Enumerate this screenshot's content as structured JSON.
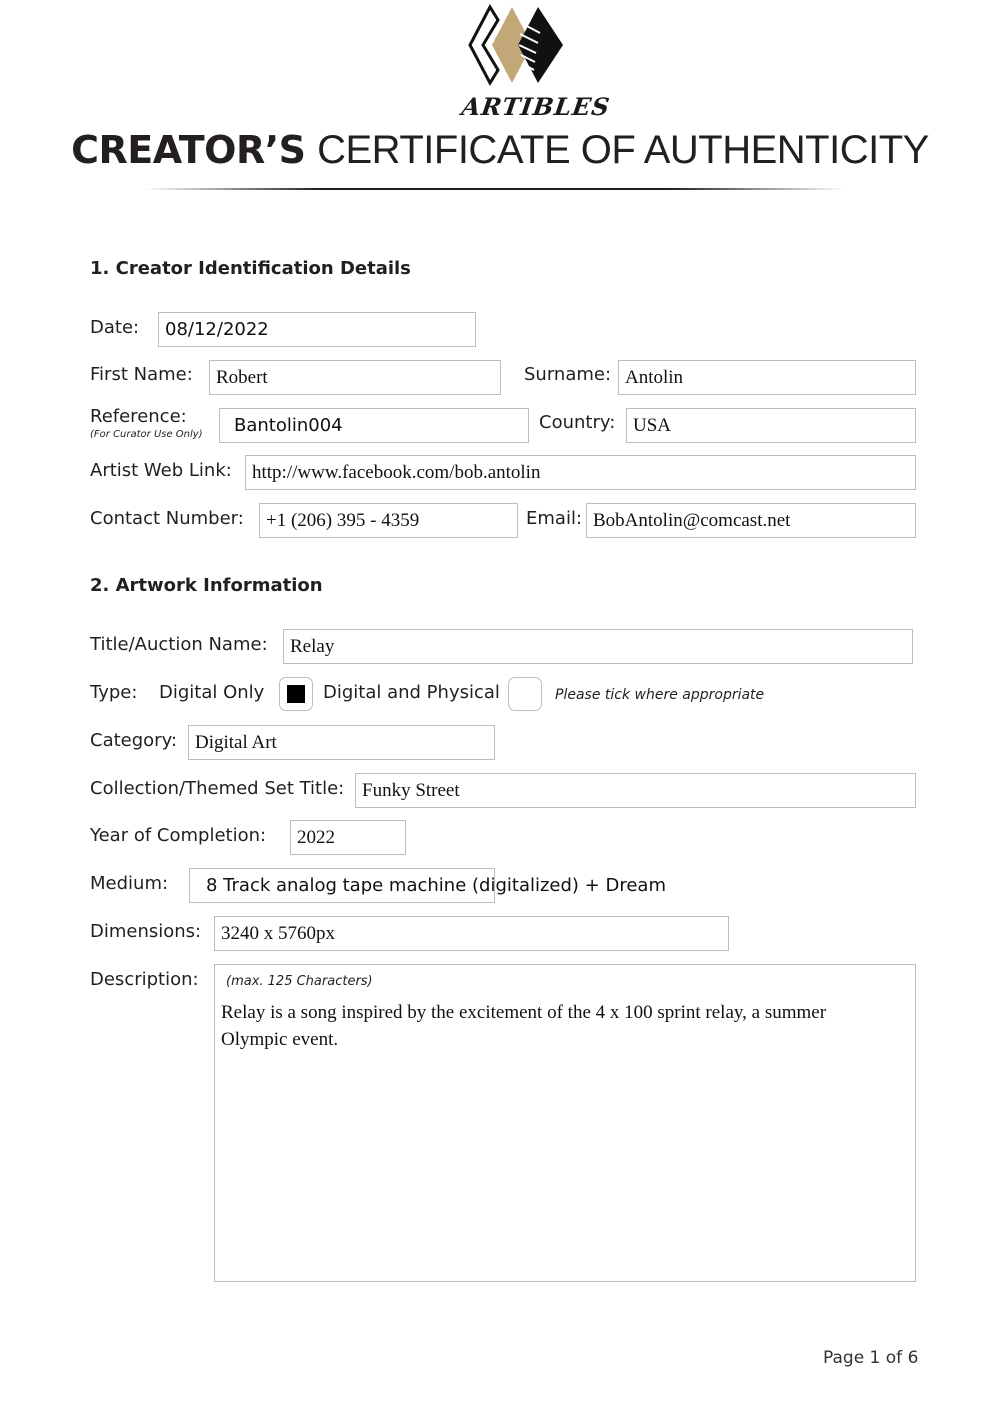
{
  "header": {
    "brand_name": "ARTIBLES",
    "title_bold": "CREATOR’S",
    "title_light": "CERTIFICATE OF AUTHENTICITY",
    "brand_colors": {
      "gold": "#c2a878",
      "black": "#111111"
    }
  },
  "section1": {
    "heading": "1. Creator Identification Details",
    "date": {
      "label": "Date:",
      "value": "08/12/2022"
    },
    "first_name": {
      "label": "First Name:",
      "value": "Robert"
    },
    "surname": {
      "label": "Surname:",
      "value": "Antolin"
    },
    "reference": {
      "label": "Reference:",
      "sublabel": "(For Curator Use Only)",
      "value": "Bantolin004"
    },
    "country": {
      "label": "Country:",
      "value": "USA"
    },
    "web_link": {
      "label": "Artist Web Link:",
      "value": "http://www.facebook.com/bob.antolin"
    },
    "contact": {
      "label": "Contact Number:",
      "value": "+1 (206) 395 - 4359"
    },
    "email": {
      "label": "Email:",
      "value": "BobAntolin@comcast.net"
    }
  },
  "section2": {
    "heading": "2. Artwork Information",
    "title": {
      "label": "Title/Auction Name:",
      "value": "Relay"
    },
    "type": {
      "label": "Type:",
      "options": [
        {
          "label": "Digital Only",
          "checked": true
        },
        {
          "label": "Digital and Physical",
          "checked": false
        }
      ],
      "hint": "Please tick where appropriate"
    },
    "category": {
      "label": "Category:",
      "value": "Digital Art"
    },
    "collection": {
      "label": "Collection/Themed Set Title:",
      "value": "Funky Street"
    },
    "year": {
      "label": "Year of Completion:",
      "value": "2022"
    },
    "medium": {
      "label": "Medium:",
      "value": "8 Track analog tape machine (digitalized) + Dream"
    },
    "dimensions": {
      "label": "Dimensions:",
      "value": "3240 x 5760px"
    },
    "description": {
      "label": "Description:",
      "note": "(max. 125 Characters)",
      "value": "Relay is a song inspired by the excitement of the 4 x 100 sprint relay, a summer Olympic event."
    }
  },
  "footer": {
    "page_label": "Page 1 of 6"
  }
}
